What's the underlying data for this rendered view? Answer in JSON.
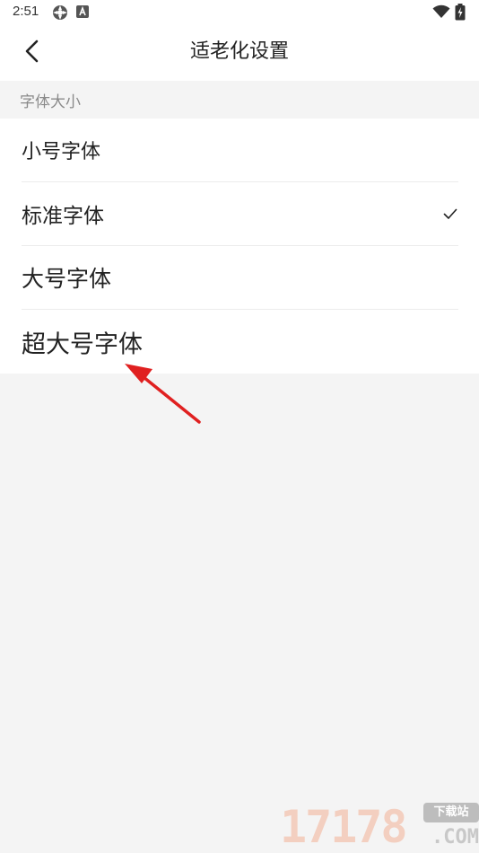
{
  "status_bar": {
    "time": "2:51",
    "icons": [
      "settings-flower-icon",
      "a-badge-icon",
      "wifi-icon",
      "battery-charging-icon"
    ]
  },
  "header": {
    "title": "适老化设置",
    "back_icon": "chevron-left-icon"
  },
  "section": {
    "title": "字体大小"
  },
  "font_options": [
    {
      "label": "小号字体",
      "selected": false
    },
    {
      "label": "标准字体",
      "selected": true
    },
    {
      "label": "大号字体",
      "selected": false
    },
    {
      "label": "超大号字体",
      "selected": false
    }
  ],
  "selected_icon": "checkmark-icon",
  "annotation": {
    "icon": "red-arrow-icon",
    "color": "#e02020"
  },
  "watermark": {
    "digits": "17178",
    "badge": "下载站",
    "suffix": ".COM"
  },
  "colors": {
    "background": "#f4f4f4",
    "surface": "#ffffff",
    "section_text": "#8a8a8a",
    "primary_text": "#222222"
  }
}
